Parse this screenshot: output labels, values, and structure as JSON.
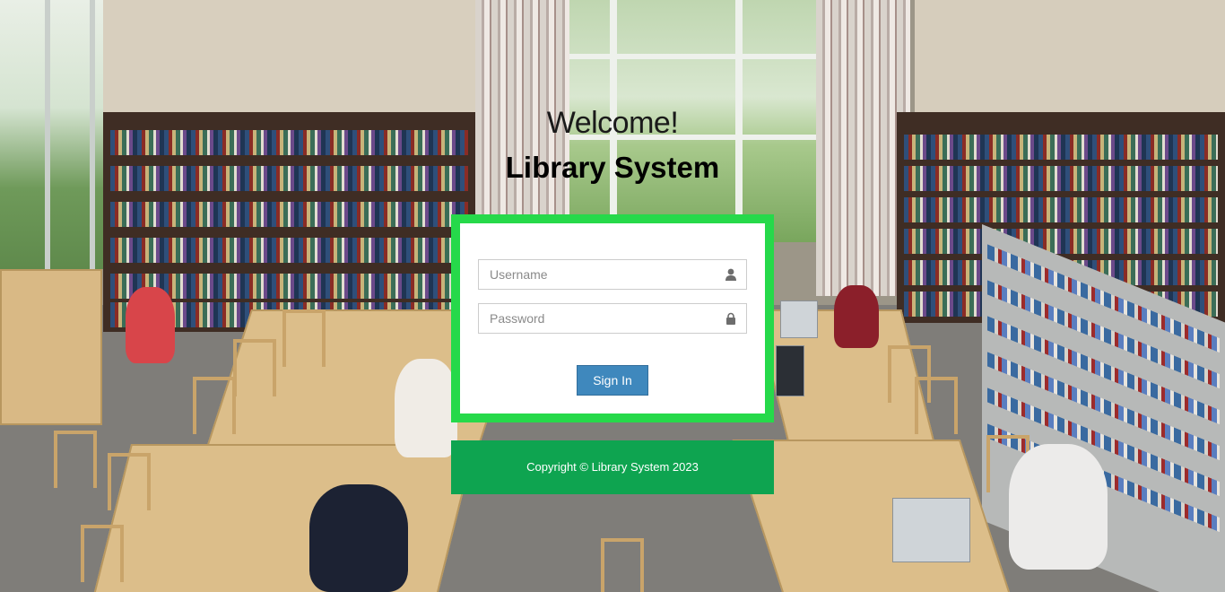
{
  "header": {
    "welcome": "Welcome!",
    "title": "Library System"
  },
  "login": {
    "username_placeholder": "Username",
    "username_icon": "user-icon",
    "password_placeholder": "Password",
    "password_icon": "lock-icon",
    "signin_label": "Sign In"
  },
  "footer": {
    "copyright": "Copyright © Library System 2023"
  },
  "colors": {
    "panel_border": "#26d94a",
    "footer_bg": "#0ea450",
    "button_bg": "#3f88bd"
  }
}
